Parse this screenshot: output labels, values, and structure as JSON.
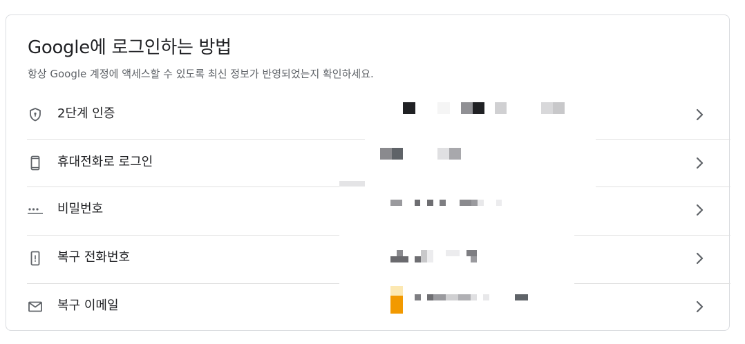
{
  "section": {
    "title": "Google에 로그인하는 방법",
    "subtitle": "항상 Google 계정에 액세스할 수 있도록 최신 정보가 반영되었는지 확인하세요."
  },
  "rows": [
    {
      "label": "2단계 인증",
      "icon": "shield-icon"
    },
    {
      "label": "휴대전화로 로그인",
      "icon": "smartphone-icon"
    },
    {
      "label": "비밀번호",
      "icon": "password-icon"
    },
    {
      "label": "복구 전화번호",
      "icon": "phone-alert-icon"
    },
    {
      "label": "복구 이메일",
      "icon": "mail-icon"
    }
  ],
  "colors": {
    "text_primary": "#202124",
    "text_secondary": "#5f6368",
    "icon": "#5f6368",
    "divider": "#e0e0e0",
    "border": "#dadce0",
    "redaction_dark": "#202124",
    "redaction_gray": "#8a8a8e",
    "redaction_orange": "#f29900"
  }
}
